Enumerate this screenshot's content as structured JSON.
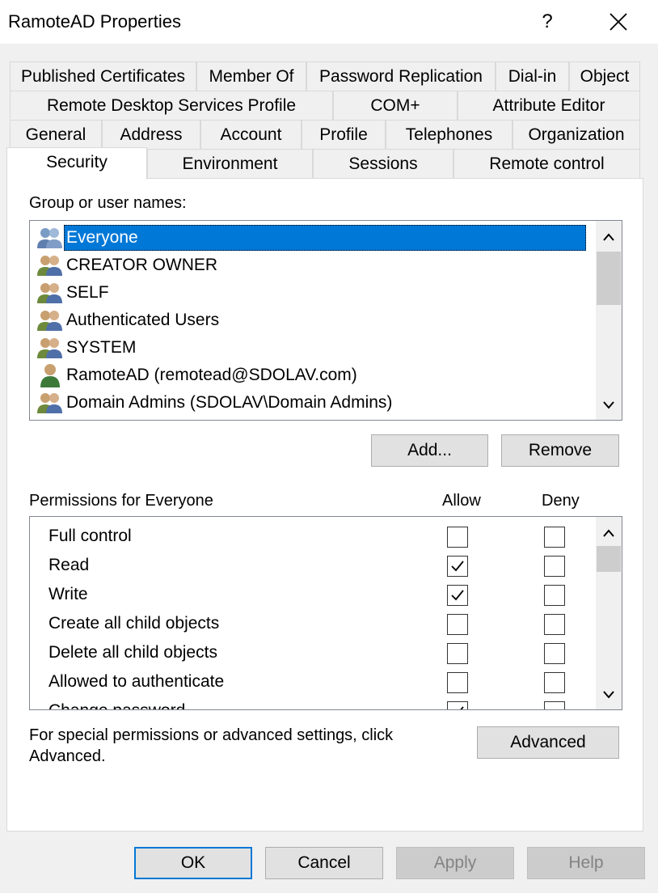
{
  "window": {
    "title": "RamoteAD Properties",
    "help_glyph": "?"
  },
  "tabs": {
    "row1": [
      "Published Certificates",
      "Member Of",
      "Password Replication",
      "Dial-in",
      "Object"
    ],
    "row2": [
      "Remote Desktop Services Profile",
      "COM+",
      "Attribute Editor"
    ],
    "row3": [
      "General",
      "Address",
      "Account",
      "Profile",
      "Telephones",
      "Organization"
    ],
    "row4": [
      "Security",
      "Environment",
      "Sessions",
      "Remote control"
    ],
    "active": "Security"
  },
  "security": {
    "group_label": "Group or user names:",
    "users": [
      {
        "name": "Everyone",
        "icon": "group-icon",
        "selected": true
      },
      {
        "name": "CREATOR OWNER",
        "icon": "group-icon"
      },
      {
        "name": "SELF",
        "icon": "group-icon"
      },
      {
        "name": "Authenticated Users",
        "icon": "group-icon"
      },
      {
        "name": "SYSTEM",
        "icon": "group-icon"
      },
      {
        "name": "RamoteAD (remotead@SDOLAV.com)",
        "icon": "user-icon"
      },
      {
        "name": "Domain Admins (SDOLAV\\Domain Admins)",
        "icon": "group-icon"
      }
    ],
    "add_label": "Add...",
    "remove_label": "Remove",
    "permissions_label": "Permissions for Everyone",
    "allow_label": "Allow",
    "deny_label": "Deny",
    "permissions": [
      {
        "name": "Full control",
        "allow": false,
        "deny": false
      },
      {
        "name": "Read",
        "allow": true,
        "deny": false
      },
      {
        "name": "Write",
        "allow": true,
        "deny": false
      },
      {
        "name": "Create all child objects",
        "allow": false,
        "deny": false
      },
      {
        "name": "Delete all child objects",
        "allow": false,
        "deny": false
      },
      {
        "name": "Allowed to authenticate",
        "allow": false,
        "deny": false
      },
      {
        "name": "Change password",
        "allow": true,
        "deny": false
      }
    ],
    "advanced_text_line1": "For special permissions or advanced settings, click",
    "advanced_text_line2": "Advanced.",
    "advanced_label": "Advanced"
  },
  "footer": {
    "ok_label": "OK",
    "cancel_label": "Cancel",
    "apply_label": "Apply",
    "help_label": "Help"
  },
  "colors": {
    "selection": "#0078d7",
    "panel": "#ffffff",
    "dialog_bg": "#f0f0f0"
  }
}
